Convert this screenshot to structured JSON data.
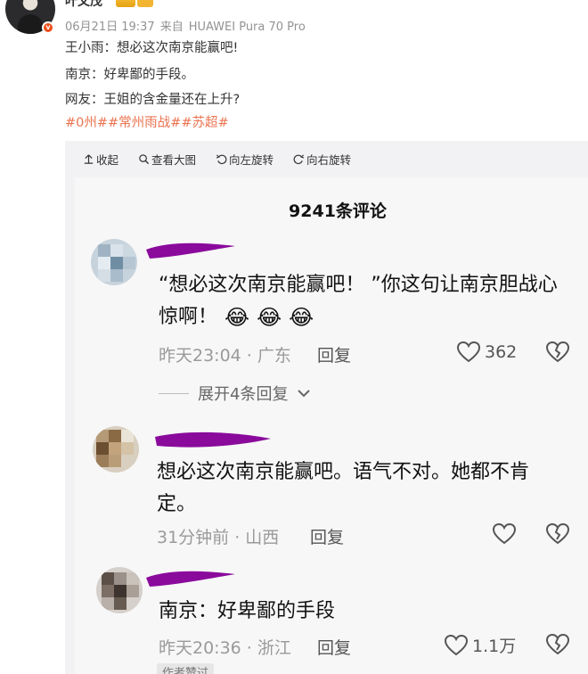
{
  "post": {
    "author": "叶文茂",
    "date": "06月21日 19:37",
    "source_prefix": "来自",
    "source": "HUAWEI Pura 70 Pro",
    "lines": [
      "王小雨：想必这次南京能赢吧!",
      "南京：好卑鄙的手段。",
      "网友：王姐的含金量还在上升?"
    ],
    "tags": "#0州##常州雨战##苏超#",
    "colors": {
      "tag": "#eb7350",
      "meta": "#939393"
    }
  },
  "toolbar": {
    "collapse": "收起",
    "view_large": "查看大图",
    "rotate_left": "向左旋转",
    "rotate_right": "向右旋转"
  },
  "screenshot": {
    "title": "9241条评论",
    "comments": [
      {
        "text_line1": "“想必这次南京能赢吧！ ”你这句让南京胆战心",
        "text_line2": "惊啊！",
        "meta": "昨天23:04 · 广东",
        "reply": "回复",
        "likes": "362"
      },
      {
        "text_line1": "想必这次南京能赢吧。语气不对。她都不肯",
        "text_line2": "定。",
        "meta": "31分钟前 · 山西",
        "reply": "回复",
        "likes": ""
      },
      {
        "text_line1": "南京：好卑鄙的手段",
        "meta": "昨天20:36 · 浙江",
        "reply": "回复",
        "likes": "1.1万",
        "tag": "作者赞过"
      }
    ],
    "expand_replies": "展开4条回复"
  }
}
